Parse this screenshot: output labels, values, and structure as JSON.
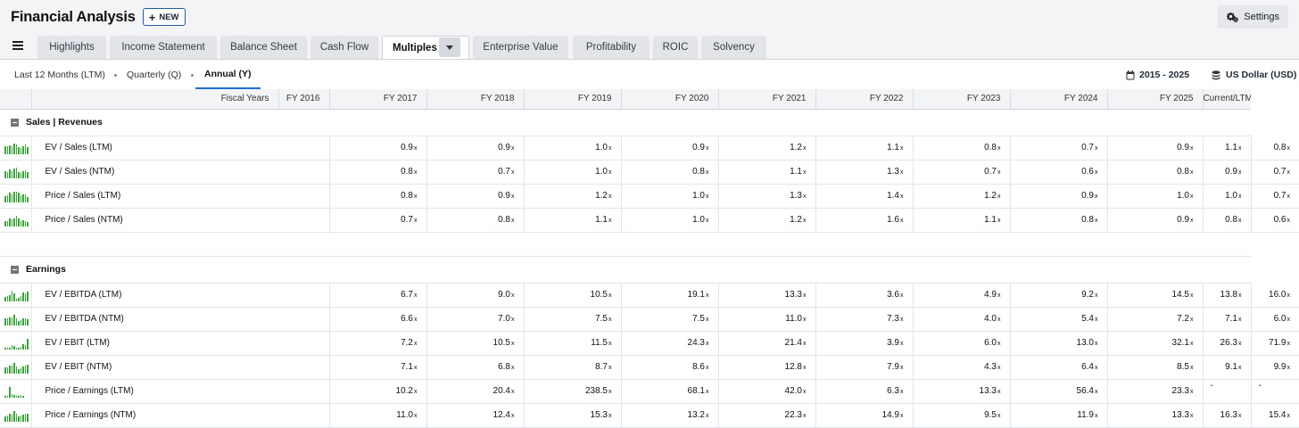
{
  "header": {
    "title": "Financial Analysis",
    "new_label": "NEW",
    "settings_label": "Settings"
  },
  "tabs": [
    {
      "label": "Highlights"
    },
    {
      "label": "Income Statement"
    },
    {
      "label": "Balance Sheet"
    },
    {
      "label": "Cash Flow"
    },
    {
      "label": "Multiples",
      "active": true
    },
    {
      "label": "Enterprise Value"
    },
    {
      "label": "Profitability"
    },
    {
      "label": "ROIC"
    },
    {
      "label": "Solvency"
    }
  ],
  "periods": [
    {
      "label": "Last 12 Months (LTM)"
    },
    {
      "label": "Quarterly (Q)"
    },
    {
      "label": "Annual (Y)",
      "active": true
    }
  ],
  "date_range": "2015 - 2025",
  "currency": "US Dollar (USD)",
  "table": {
    "header_label": "Fiscal Years",
    "columns": [
      "FY 2016",
      "FY 2017",
      "FY 2018",
      "FY 2019",
      "FY 2020",
      "FY 2021",
      "FY 2022",
      "FY 2023",
      "FY 2024",
      "FY 2025",
      "Current/LTM"
    ],
    "value_suffix": "x",
    "sections": [
      {
        "title": "Sales | Revenues",
        "rows": [
          {
            "label": "EV / Sales (LTM)",
            "values": [
              "0.9",
              "0.9",
              "1.0",
              "0.9",
              "1.2",
              "1.1",
              "0.8",
              "0.7",
              "0.9",
              "1.1",
              "0.8"
            ]
          },
          {
            "label": "EV / Sales (NTM)",
            "values": [
              "0.8",
              "0.7",
              "1.0",
              "0.8",
              "1.1",
              "1.3",
              "0.7",
              "0.6",
              "0.8",
              "0.9",
              "0.7"
            ]
          },
          {
            "label": "Price / Sales (LTM)",
            "values": [
              "0.8",
              "0.9",
              "1.2",
              "1.0",
              "1.3",
              "1.4",
              "1.2",
              "0.9",
              "1.0",
              "1.0",
              "0.7"
            ]
          },
          {
            "label": "Price / Sales (NTM)",
            "values": [
              "0.7",
              "0.8",
              "1.1",
              "1.0",
              "1.2",
              "1.6",
              "1.1",
              "0.8",
              "0.9",
              "0.8",
              "0.6"
            ]
          }
        ]
      },
      {
        "title": "Earnings",
        "rows": [
          {
            "label": "EV / EBITDA (LTM)",
            "values": [
              "6.7",
              "9.0",
              "10.5",
              "19.1",
              "13.3",
              "3.6",
              "4.9",
              "9.2",
              "14.5",
              "13.8",
              "16.0"
            ]
          },
          {
            "label": "EV / EBITDA (NTM)",
            "values": [
              "6.6",
              "7.0",
              "7.5",
              "7.5",
              "11.0",
              "7.3",
              "4.0",
              "5.4",
              "7.2",
              "7.1",
              "6.0"
            ]
          },
          {
            "label": "EV / EBIT (LTM)",
            "values": [
              "7.2",
              "10.5",
              "11.5",
              "24.3",
              "21.4",
              "3.9",
              "6.0",
              "13.0",
              "32.1",
              "26.3",
              "71.9"
            ]
          },
          {
            "label": "EV / EBIT (NTM)",
            "values": [
              "7.1",
              "6.8",
              "8.7",
              "8.6",
              "12.8",
              "7.9",
              "4.3",
              "6.4",
              "8.5",
              "9.1",
              "9.9"
            ]
          },
          {
            "label": "Price / Earnings (LTM)",
            "values": [
              "10.2",
              "20.4",
              "238.5",
              "68.1",
              "42.0",
              "6.3",
              "13.3",
              "56.4",
              "23.3",
              "-",
              "-"
            ]
          },
          {
            "label": "Price / Earnings (NTM)",
            "values": [
              "11.0",
              "12.4",
              "15.3",
              "13.2",
              "22.3",
              "14.9",
              "9.5",
              "11.9",
              "13.3",
              "16.3",
              "15.4"
            ]
          }
        ]
      }
    ]
  },
  "colors": {
    "accent": "#1f6fd1",
    "sparkline": "#3aa33a"
  }
}
